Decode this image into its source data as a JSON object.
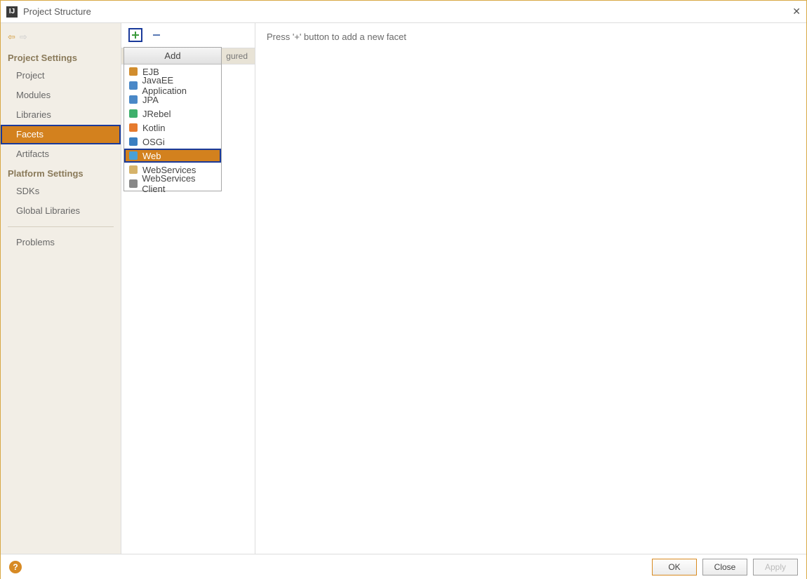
{
  "window": {
    "title": "Project Structure",
    "app_glyph": "IJ"
  },
  "sidebar": {
    "section1_title": "Project Settings",
    "items1": [
      "Project",
      "Modules",
      "Libraries",
      "Facets",
      "Artifacts"
    ],
    "selected1_index": 3,
    "section2_title": "Platform Settings",
    "items2": [
      "SDKs",
      "Global Libraries"
    ],
    "problems": "Problems"
  },
  "middle": {
    "badge_text": "gured"
  },
  "dropdown": {
    "title": "Add",
    "items": [
      {
        "label": "EJB",
        "icon_color": "#d18d2e"
      },
      {
        "label": "JavaEE Application",
        "icon_color": "#4a88c7"
      },
      {
        "label": "JPA",
        "icon_color": "#4a88c7"
      },
      {
        "label": "JRebel",
        "icon_color": "#3eb06c"
      },
      {
        "label": "Kotlin",
        "icon_color": "#e67b2e"
      },
      {
        "label": "OSGi",
        "icon_color": "#3a7fc1"
      },
      {
        "label": "Web",
        "icon_color": "#4aa0d6"
      },
      {
        "label": "WebServices",
        "icon_color": "#d6b36a"
      },
      {
        "label": "WebServices Client",
        "icon_color": "#888888"
      }
    ],
    "selected_index": 6
  },
  "main": {
    "hint": "Press '+' button to add a new facet"
  },
  "footer": {
    "ok": "OK",
    "close": "Close",
    "apply": "Apply",
    "help_glyph": "?"
  }
}
